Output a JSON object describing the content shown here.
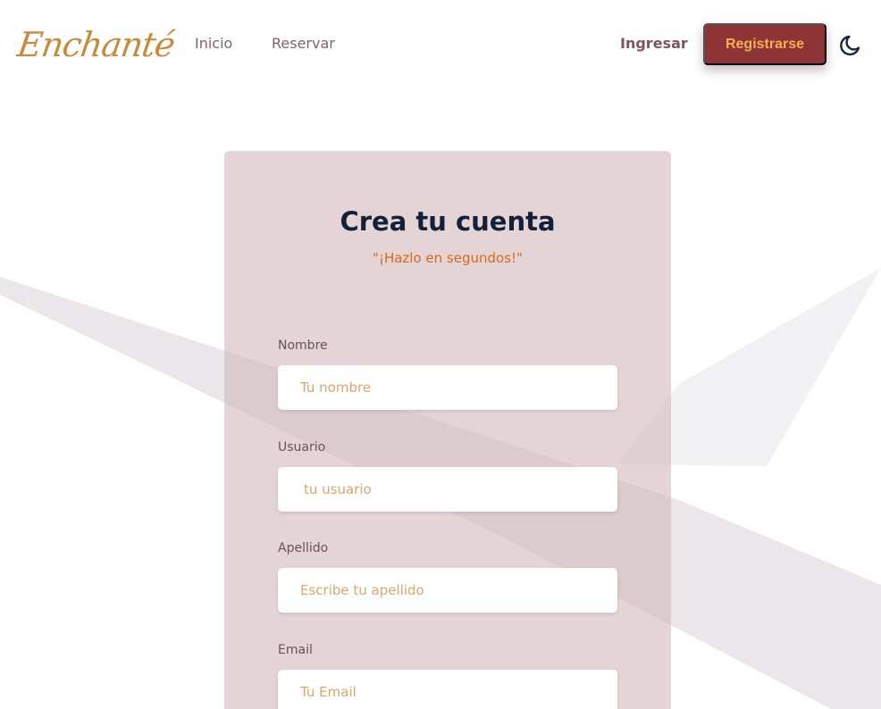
{
  "logo": {
    "text": "Enchanté"
  },
  "nav": {
    "links": [
      {
        "label": "Inicio"
      },
      {
        "label": "Reservar"
      }
    ],
    "login_label": "Ingresar",
    "register_label": "Registrarse",
    "theme_icon": "moon-icon"
  },
  "form": {
    "title": "Crea tu cuenta",
    "subtitle": "\"¡Hazlo en segundos!\"",
    "fields": [
      {
        "label": "Nombre",
        "placeholder": "Tu nombre",
        "value": ""
      },
      {
        "label": "Usuario",
        "placeholder": "tu usuario",
        "value": ""
      },
      {
        "label": "Apellido",
        "placeholder": "Escribe tu apellido",
        "value": ""
      },
      {
        "label": "Email",
        "placeholder": "Tu Email",
        "value": ""
      }
    ]
  },
  "colors": {
    "accent": "#8e3336",
    "accent_text": "#f2b24e",
    "title": "#122039",
    "subtitle": "#d8691b",
    "logo": "#c98a3a",
    "card_background": "#e4d3d4"
  }
}
